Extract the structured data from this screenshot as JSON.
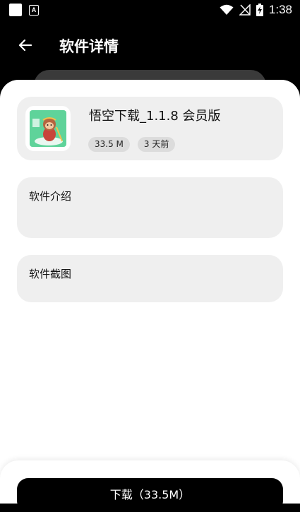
{
  "status_bar": {
    "time": "1:38"
  },
  "header": {
    "title": "软件详情"
  },
  "app": {
    "name": "悟空下载_1.1.8 会员版",
    "size": "33.5 M",
    "updated": "3 天前"
  },
  "sections": {
    "intro_label": "软件介绍",
    "screenshots_label": "软件截图"
  },
  "footer": {
    "download_label": "下载（33.5M）"
  },
  "colors": {
    "background": "#000000",
    "card": "#efefef",
    "tag": "#dcdcdc",
    "icon_green": "#5fd39a"
  }
}
